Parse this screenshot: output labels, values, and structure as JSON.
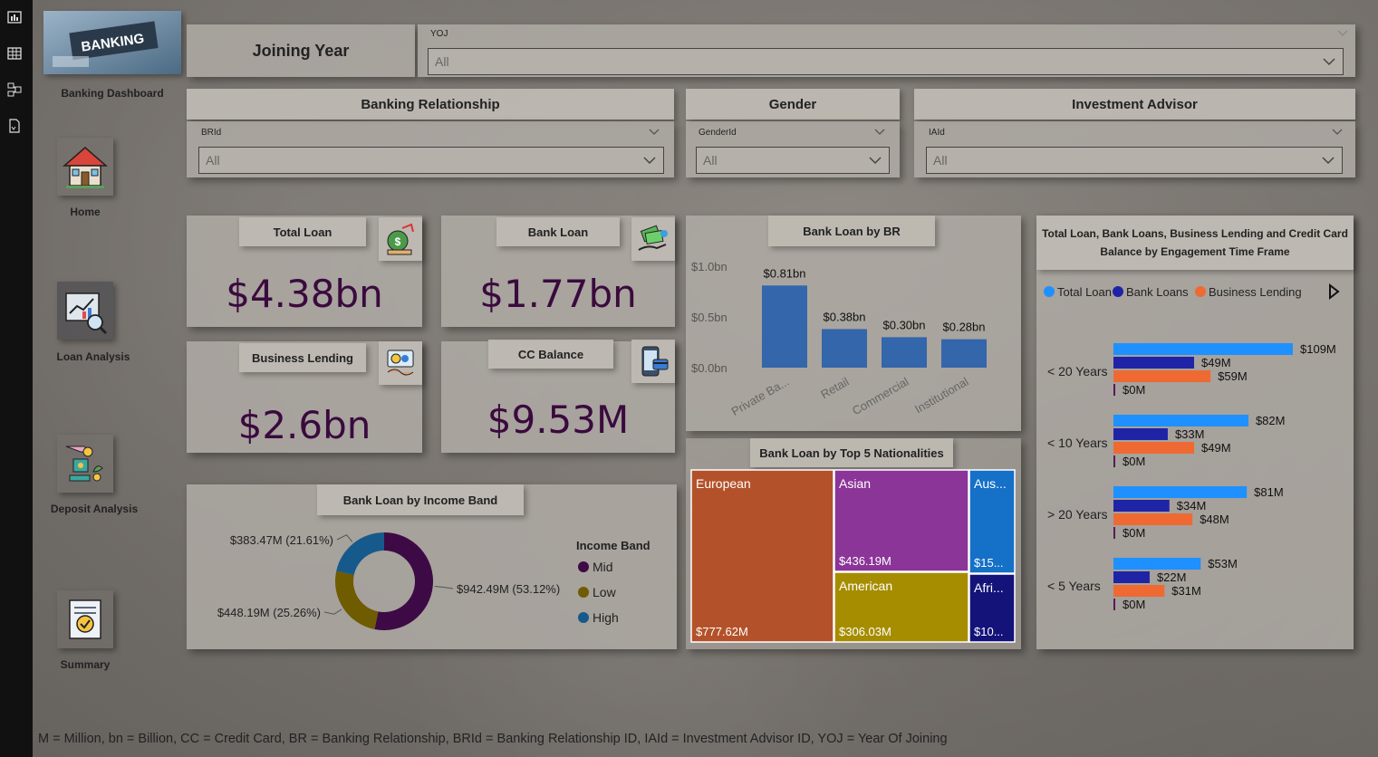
{
  "nav": {
    "title": "Banking Dashboard",
    "banner_text": "BANKING",
    "items": [
      {
        "label": "Home"
      },
      {
        "label": "Loan Analysis"
      },
      {
        "label": "Deposit Analysis"
      },
      {
        "label": "Summary"
      }
    ]
  },
  "filters": {
    "joining_year": {
      "title": "Joining Year",
      "field": "YOJ",
      "value": "All"
    },
    "banking_relationship": {
      "title": "Banking Relationship",
      "field": "BRId",
      "value": "All"
    },
    "gender": {
      "title": "Gender",
      "field": "GenderId",
      "value": "All"
    },
    "investment_advisor": {
      "title": "Investment Advisor",
      "field": "IAId",
      "value": "All"
    }
  },
  "kpis": {
    "total_loan": {
      "title": "Total Loan",
      "value": "$4.38bn"
    },
    "bank_loan": {
      "title": "Bank Loan",
      "value": "$1.77bn"
    },
    "business_lending": {
      "title": "Business Lending",
      "value": "$2.6bn"
    },
    "cc_balance": {
      "title": "CC Balance",
      "value": "$9.53M"
    }
  },
  "colors": {
    "kpi_value": "#3a0a3e",
    "bar_blue": "#3366aa",
    "total_loan": "#1e90ff",
    "bank_loans": "#1f24a6",
    "business_lending": "#ee6a32",
    "donut_mid": "#3d0a45",
    "donut_low": "#6f5b00",
    "donut_high": "#165a8c",
    "tm_european": "#b3522a",
    "tm_asian": "#8b3598",
    "tm_american": "#a68d00",
    "tm_australian": "#1570c8",
    "tm_african": "#13137a"
  },
  "chart_data": [
    {
      "type": "bar",
      "title": "Bank Loan by BR",
      "categories": [
        "Private Ba...",
        "Retail",
        "Commercial",
        "Institutional"
      ],
      "values": [
        0.81,
        0.38,
        0.3,
        0.28
      ],
      "data_labels": [
        "$0.81bn",
        "$0.38bn",
        "$0.30bn",
        "$0.28bn"
      ],
      "ytick_labels": [
        "$1.0bn",
        "$0.5bn",
        "$0.0bn"
      ],
      "yticks": [
        1.0,
        0.5,
        0.0
      ],
      "ylim": [
        0,
        1.0
      ]
    },
    {
      "type": "pie",
      "title": "Bank Loan by Income Band",
      "legend_title": "Income Band",
      "slices": [
        {
          "name": "Mid",
          "value": 942.49,
          "label": "$942.49M (53.12%)"
        },
        {
          "name": "Low",
          "value": 448.19,
          "label": "$448.19M (25.26%)"
        },
        {
          "name": "High",
          "value": 383.47,
          "label": "$383.47M (21.61%)"
        }
      ]
    },
    {
      "type": "treemap",
      "title": "Bank Loan by Top 5 Nationalities",
      "items": [
        {
          "name": "European",
          "value": 777.62,
          "label": "$777.62M"
        },
        {
          "name": "Asian",
          "value": 436.19,
          "label": "$436.19M"
        },
        {
          "name": "American",
          "value": 306.03,
          "label": "$306.03M"
        },
        {
          "name": "Aus...",
          "label": "$15..."
        },
        {
          "name": "Afri...",
          "label": "$10..."
        }
      ]
    },
    {
      "type": "bar",
      "orientation": "horizontal",
      "title": "Total Loan, Bank Loans, Business Lending and Credit Card Balance by Engagement Time Frame",
      "categories": [
        "< 20 Years",
        "< 10 Years",
        "> 20 Years",
        "< 5 Years"
      ],
      "series": [
        {
          "name": "Total Loan",
          "values": [
            109,
            82,
            81,
            53
          ],
          "labels": [
            "$109M",
            "$82M",
            "$81M",
            "$53M"
          ]
        },
        {
          "name": "Bank Loans",
          "values": [
            49,
            33,
            34,
            22
          ],
          "labels": [
            "$49M",
            "$33M",
            "$34M",
            "$22M"
          ]
        },
        {
          "name": "Business Lending",
          "values": [
            59,
            49,
            48,
            31
          ],
          "labels": [
            "$59M",
            "$49M",
            "$48M",
            "$31M"
          ]
        },
        {
          "values": [
            0,
            0,
            0,
            0
          ],
          "labels": [
            "$0M",
            "$0M",
            "$0M",
            "$0M"
          ]
        }
      ]
    }
  ],
  "footer": "M = Million, bn = Billion, CC = Credit Card, BR = Banking Relationship, BRId = Banking Relationship ID, IAId = Investment Advisor ID, YOJ = Year Of Joining"
}
